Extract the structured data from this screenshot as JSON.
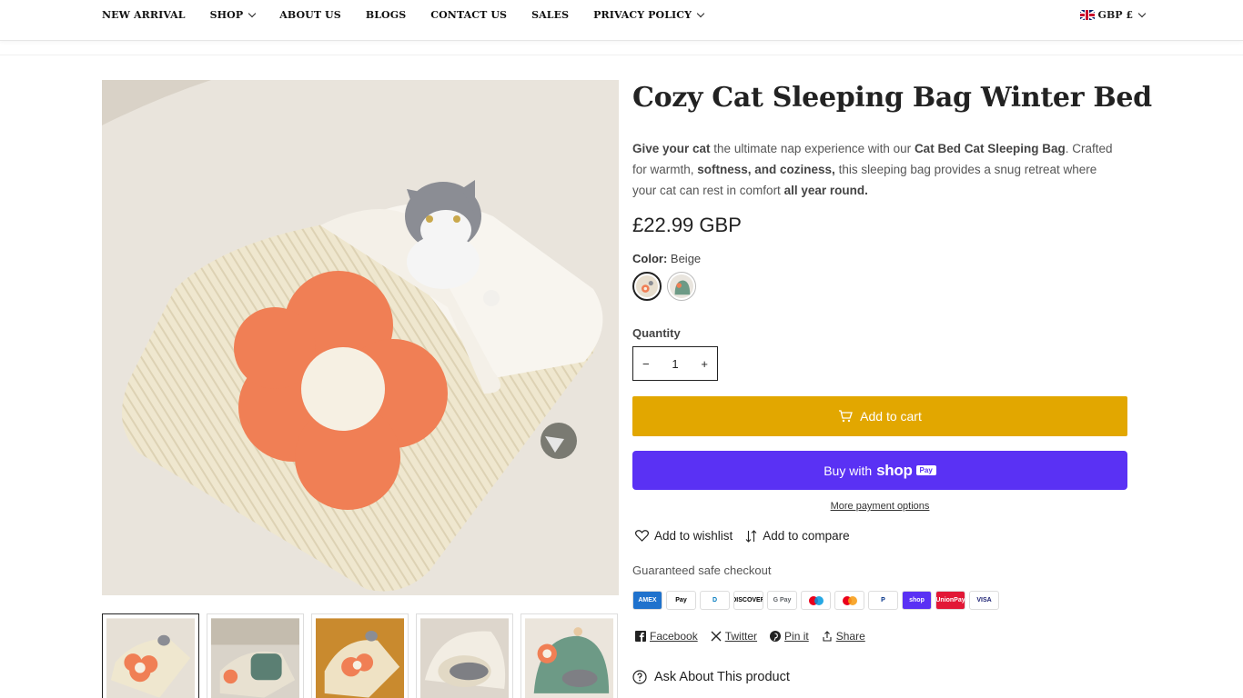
{
  "nav": {
    "items": [
      {
        "label": "NEW ARRIVAL",
        "has_dropdown": false
      },
      {
        "label": "SHOP",
        "has_dropdown": true
      },
      {
        "label": "ABOUT US",
        "has_dropdown": false
      },
      {
        "label": "BLOGS",
        "has_dropdown": false
      },
      {
        "label": "CONTACT US",
        "has_dropdown": false
      },
      {
        "label": "SALES",
        "has_dropdown": false
      },
      {
        "label": "PRIVACY POLICY",
        "has_dropdown": true
      }
    ],
    "currency": "GBP £"
  },
  "product": {
    "title": "Cozy Cat Sleeping Bag Winter Bed",
    "description": {
      "p1_bold": "Give your cat",
      "p2": " the ultimate nap experience with our ",
      "p3_bold": "Cat Bed Cat Sleeping Bag",
      "p4": ". Crafted for warmth, ",
      "p5_bold": "softness, and coziness,",
      "p6": " this sleeping bag provides a snug retreat where your cat can rest in comfort ",
      "p7_bold": "all year round."
    },
    "price": "£22.99 GBP",
    "color_label": "Color:",
    "color_value": "Beige",
    "quantity_label": "Quantity",
    "quantity_value": "1",
    "qty_minus": "−",
    "qty_plus": "+",
    "add_to_cart": "Add to cart",
    "buy_with": "Buy with",
    "buy_shop": "shop",
    "buy_pay": "Pay",
    "more_payment": "More payment options",
    "wishlist": "Add to wishlist",
    "compare": "Add to compare",
    "guaranteed": "Guaranteed safe checkout",
    "payment_methods": [
      {
        "name": "AMEX",
        "bg": "#1f72cd",
        "fg": "#ffffff"
      },
      {
        "name": "Pay",
        "bg": "#ffffff",
        "fg": "#000000"
      },
      {
        "name": "D",
        "bg": "#ffffff",
        "fg": "#0079be"
      },
      {
        "name": "DISCOVER",
        "bg": "#ffffff",
        "fg": "#000000"
      },
      {
        "name": "G Pay",
        "bg": "#ffffff",
        "fg": "#5f6368"
      },
      {
        "name": "",
        "bg": "#ffffff",
        "fg": "#000000"
      },
      {
        "name": "",
        "bg": "#ffffff",
        "fg": "#000000"
      },
      {
        "name": "P",
        "bg": "#ffffff",
        "fg": "#003087"
      },
      {
        "name": "shop",
        "bg": "#5a31f4",
        "fg": "#ffffff"
      },
      {
        "name": "UnionPay",
        "bg": "#e21836",
        "fg": "#ffffff"
      },
      {
        "name": "VISA",
        "bg": "#ffffff",
        "fg": "#1a1f71"
      }
    ],
    "share": {
      "facebook": "Facebook",
      "twitter": "Twitter",
      "pinit": "Pin it",
      "share": "Share"
    },
    "ask": "Ask About This product"
  }
}
